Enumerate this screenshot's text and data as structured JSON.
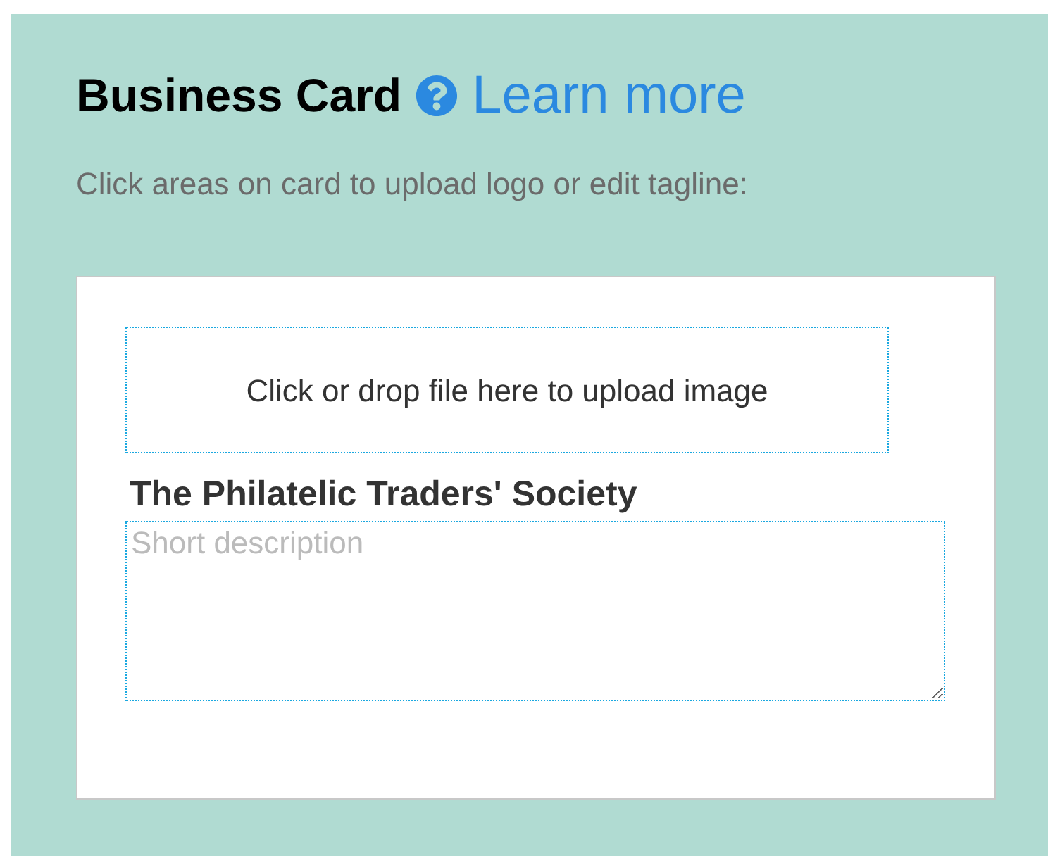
{
  "heading": {
    "title": "Business Card",
    "link": "Learn more"
  },
  "instructions": "Click areas on card to upload logo or edit tagline:",
  "card": {
    "upload_area": "Click or drop file here to upload image",
    "company_name": "The Philatelic Traders' Society",
    "description": {
      "placeholder": "Short description"
    }
  }
}
